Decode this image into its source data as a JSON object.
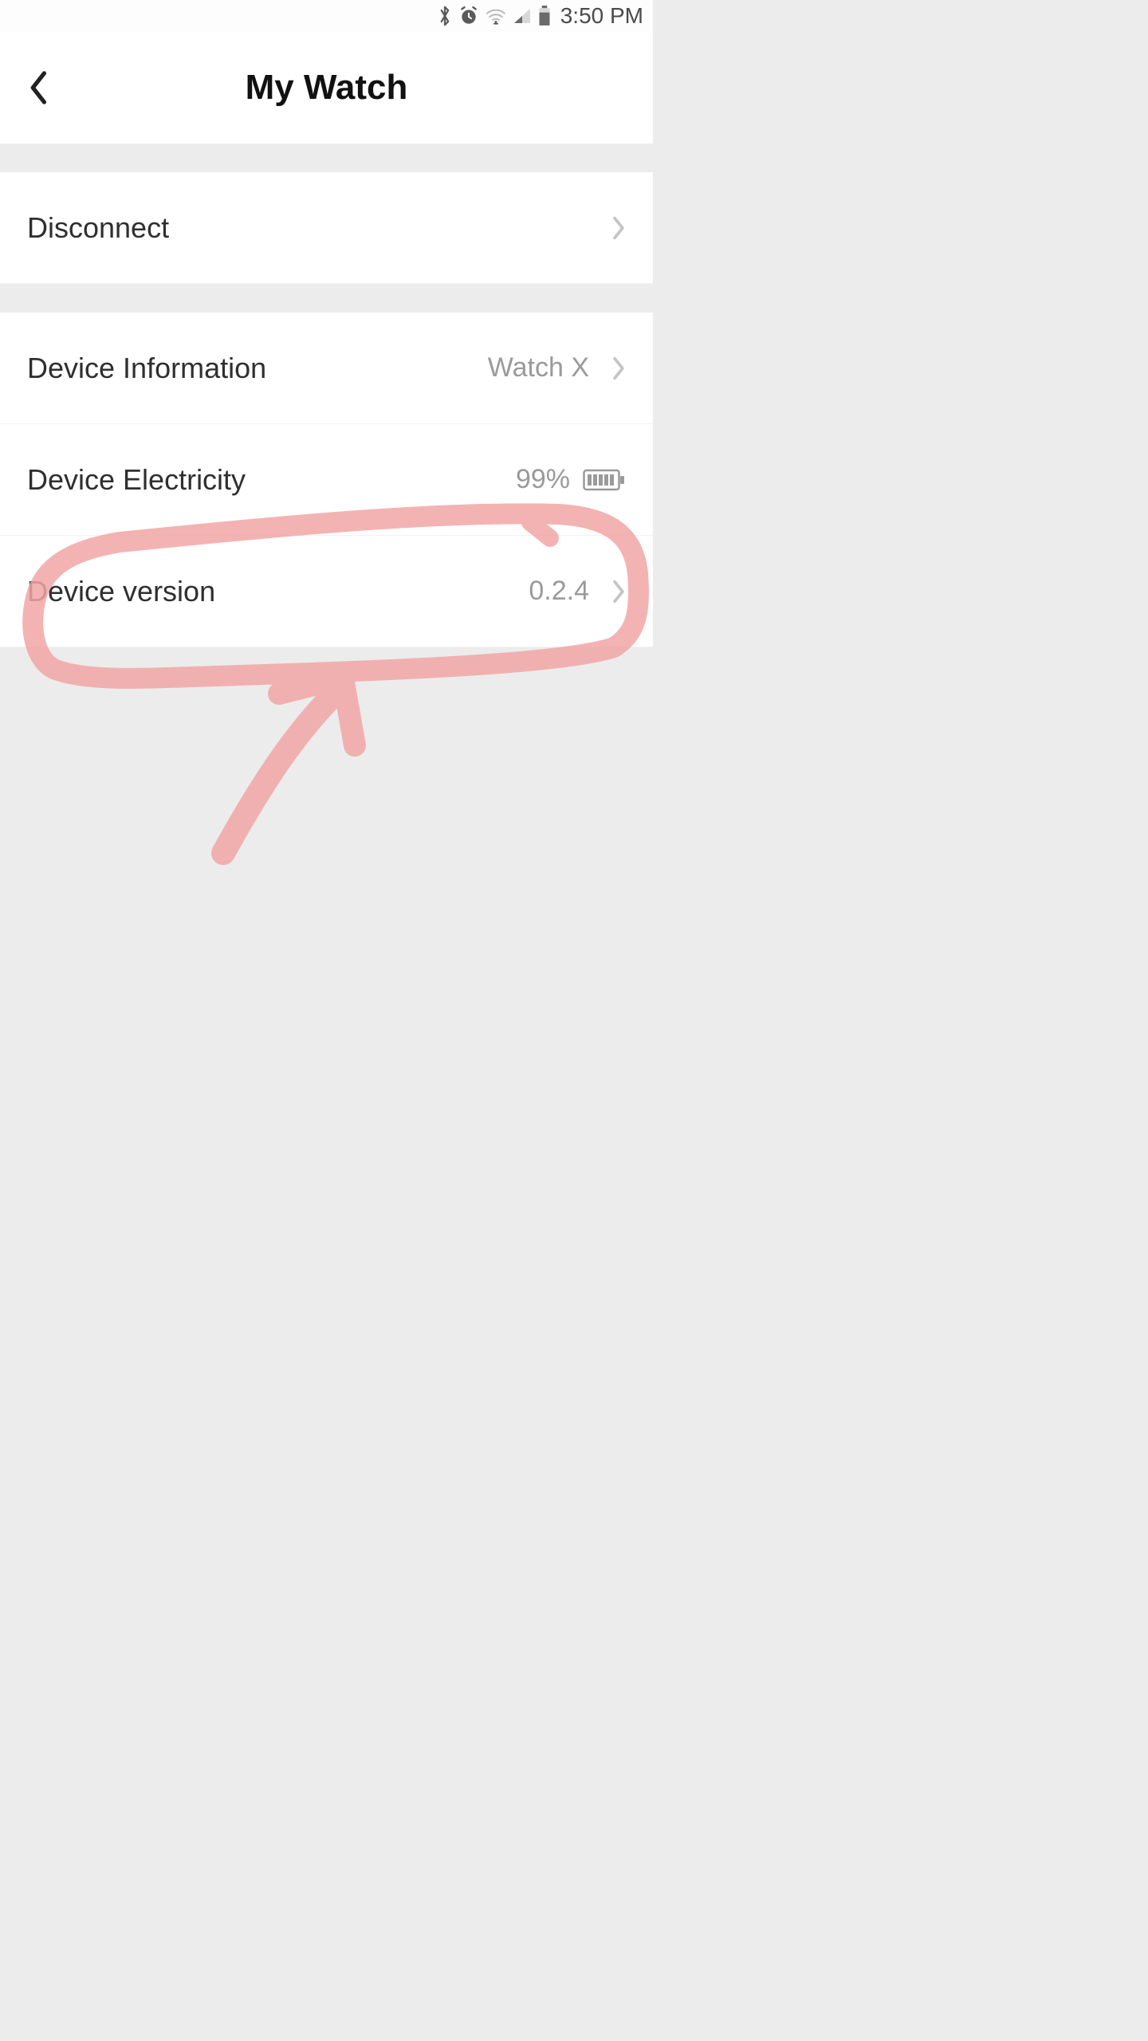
{
  "status": {
    "time": "3:50 PM"
  },
  "header": {
    "title": "My Watch"
  },
  "rows": {
    "disconnect": {
      "label": "Disconnect"
    },
    "deviceInfo": {
      "label": "Device Information",
      "value": "Watch X"
    },
    "deviceElectricity": {
      "label": "Device Electricity",
      "value": "99%"
    },
    "deviceVersion": {
      "label": "Device version",
      "value": "0.2.4"
    }
  },
  "annotation": {
    "color": "#f5b4b4",
    "highlights": "Device version row circled with arrow"
  }
}
